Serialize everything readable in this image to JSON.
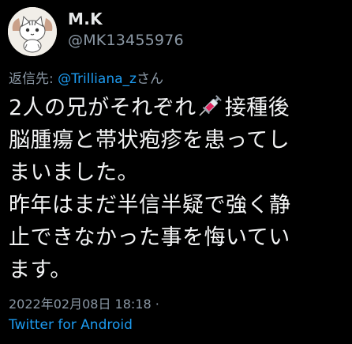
{
  "user": {
    "display_name": "M.K",
    "handle": "@MK13455976",
    "avatar_icon": "cat-avatar-icon"
  },
  "reply": {
    "prefix": "返信先: ",
    "mention": "@Trilliana_z",
    "suffix": "さん"
  },
  "tweet": {
    "lines": [
      {
        "before": "2人の兄がそれぞれ",
        "emoji": "syringe-icon",
        "after": "接種後"
      },
      {
        "text": "脳腫瘍と帯状疱疹を患ってし"
      },
      {
        "text": "まいました。"
      },
      {
        "text": "昨年はまだ半信半疑で強く静"
      },
      {
        "text": "止できなかった事を悔いてい"
      },
      {
        "text": "ます。"
      }
    ]
  },
  "meta": {
    "timestamp": "2022年02月08日 18:18 ·",
    "source": "Twitter for Android"
  },
  "colors": {
    "background": "#000000",
    "text": "#e7e9ea",
    "secondary": "#8b98a5",
    "link": "#1d9bf0"
  }
}
